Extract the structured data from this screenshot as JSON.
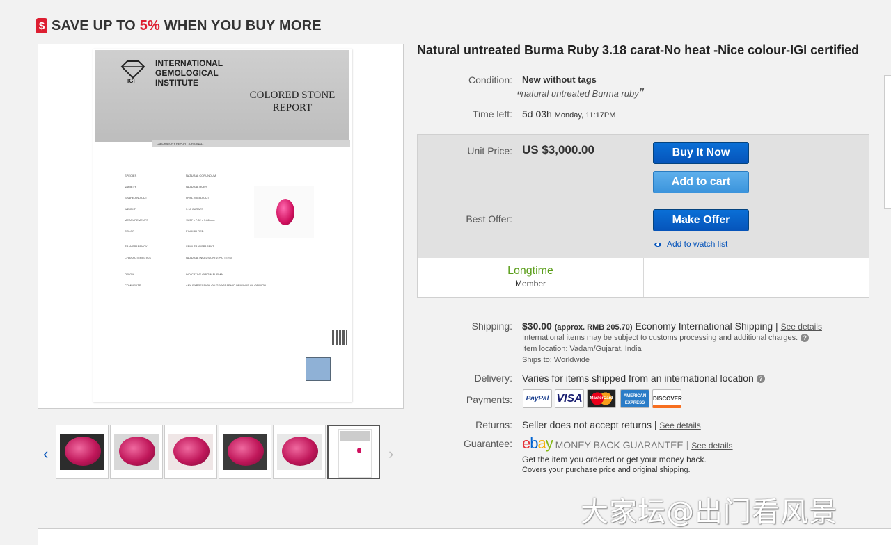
{
  "promo": {
    "prefix": "SAVE UP TO ",
    "percent": "5%",
    "suffix": " WHEN YOU BUY MORE",
    "tag_icon": "$"
  },
  "listing_image": {
    "org_name": "INTERNATIONAL GEMOLOGICAL INSTITUTE",
    "report_title": "COLORED STONE REPORT",
    "report_type": "LABORATORY REPORT (ORIGINAL)",
    "spec_labels": [
      "SPECIES",
      "VARIETY",
      "SHAPE AND CUT",
      "WEIGHT",
      "MEASUREMENTS",
      "COLOR",
      "TRANSPARENCY",
      "CHARACTERISTICS",
      "ORIGIN",
      "COMMENTS"
    ],
    "spec_values": [
      "NATURAL CORUNDUM",
      "NATURAL RUBY",
      "OVAL MIXED CUT",
      "3.18 CARATS",
      "11.37 x 7.82 x 3.86 mm",
      "PINKISH RED",
      "SEMI-TRANSPARENT",
      "NATURAL INCLUSION(S) PATTERN",
      "INDICATIVE ORIGIN BURMA",
      "ANY EXPRESSION ON GEOGRAPHIC ORIGIN IS AN OPINION"
    ]
  },
  "thumbnails": {
    "count": 6,
    "selected_index": 5
  },
  "title": "Natural untreated Burma Ruby 3.18 carat-No heat -Nice colour-IGI certified",
  "condition": {
    "label": "Condition:",
    "value": "New without tags",
    "note": "natural untreated Burma ruby"
  },
  "time_left": {
    "label": "Time left:",
    "value": "5d 03h",
    "end": "Monday, 11:17PM"
  },
  "purchase": {
    "unit_price_label": "Unit Price:",
    "price": "US $3,000.00",
    "buy_now": "Buy It Now",
    "add_to_cart": "Add to cart",
    "best_offer_label": "Best Offer:",
    "make_offer": "Make Offer",
    "watch_list": "Add to watch list",
    "seller_badge": "Longtime",
    "seller_badge_sub": "Member"
  },
  "shipping": {
    "label": "Shipping:",
    "cost": "$30.00",
    "approx": "(approx. RMB 205.70)",
    "method": "Economy International Shipping |",
    "see_details": "See details",
    "customs_note": "International items may be subject to customs processing and additional charges.",
    "item_location": "Item location:  Vadam/Gujarat, India",
    "ships_to": "Ships to:  Worldwide"
  },
  "delivery": {
    "label": "Delivery:",
    "value": "Varies for items shipped from an international location"
  },
  "payments": {
    "label": "Payments:",
    "methods": [
      "PayPal",
      "VISA",
      "MasterCard",
      "AMERICAN EXPRESS",
      "DISCOVER"
    ]
  },
  "returns": {
    "label": "Returns:",
    "value": "Seller does not accept returns |",
    "see_details": "See details"
  },
  "guarantee": {
    "label": "Guarantee:",
    "logo": "ebay",
    "title": "MONEY BACK GUARANTEE",
    "see_details": "See details",
    "line1": "Get the item you ordered or get your money back.",
    "line2": "Covers your purchase price and original shipping."
  },
  "watermark": "大家坛@出门看风景",
  "colors": {
    "accent": "#0654ba",
    "promo_red": "#dd1e31",
    "seller_green": "#5a9e1a"
  }
}
